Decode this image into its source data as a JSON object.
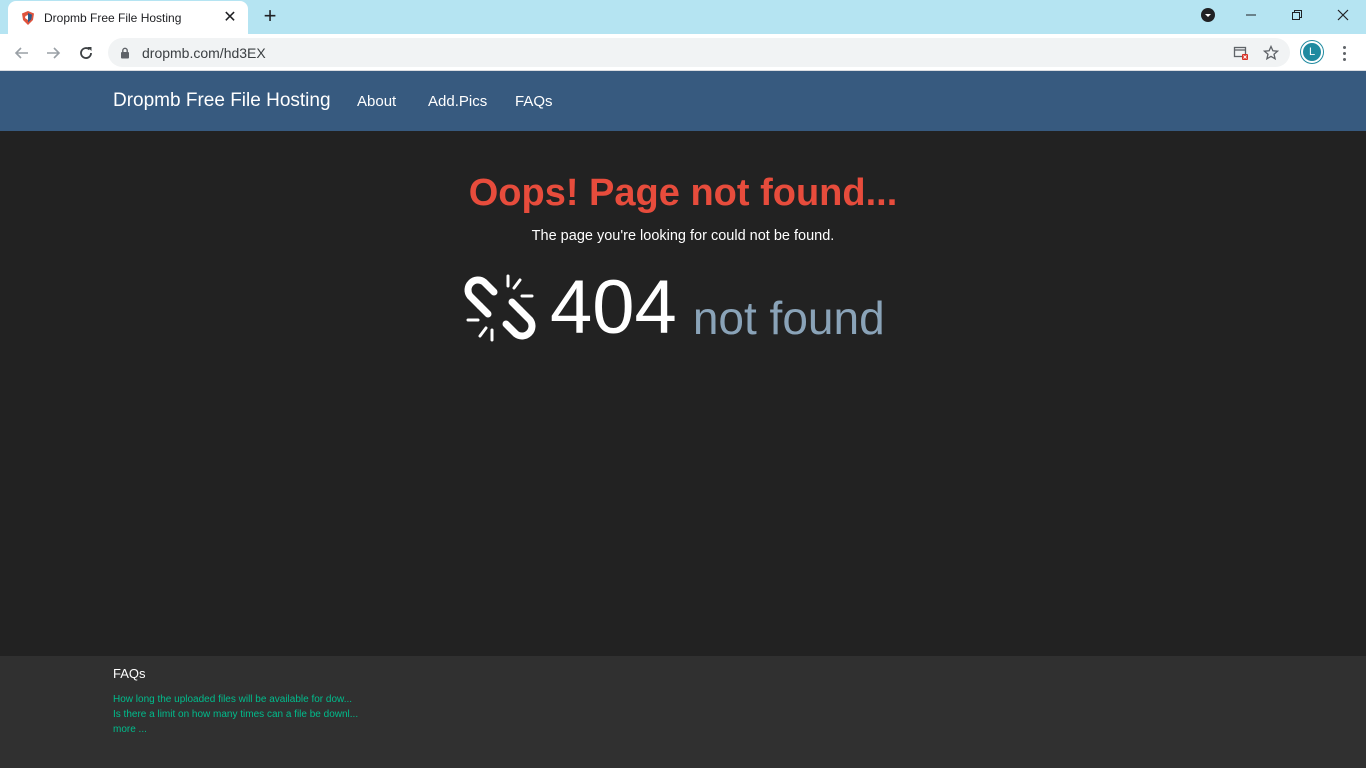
{
  "browser": {
    "tab_title": "Dropmb Free File Hosting",
    "url": "dropmb.com/hd3EX",
    "profile_initial": "L"
  },
  "site_nav": {
    "brand": "Dropmb Free File Hosting",
    "links": [
      {
        "label": "About"
      },
      {
        "label": "Add.Pics"
      },
      {
        "label": "FAQs"
      }
    ]
  },
  "error": {
    "heading": "Oops! Page not found...",
    "message": "The page you're looking for could not be found.",
    "code": "404",
    "code_text": "not found"
  },
  "footer": {
    "title": "FAQs",
    "items": [
      "How long the uploaded files will be available for dow...",
      "Is there a limit on how many times can a file be downl..."
    ],
    "more": "more ..."
  },
  "colors": {
    "tabstrip": "#b5e4f2",
    "navbar": "#375a7f",
    "page_bg": "#222222",
    "footer_bg": "#303030",
    "error_heading": "#e74c3c",
    "link_green": "#00bc8c",
    "not_found_text": "#8aa3b8"
  },
  "icons": {
    "favicon": "shield-favicon-icon",
    "broken_link": "broken-link-icon"
  }
}
